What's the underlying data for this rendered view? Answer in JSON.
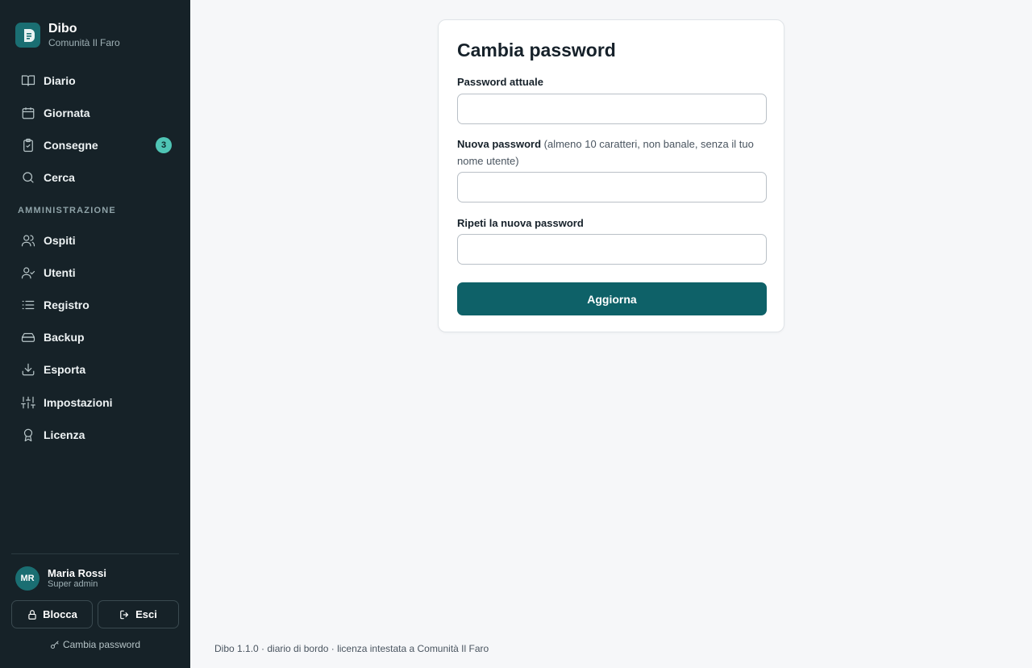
{
  "brand": {
    "name": "Dibo",
    "subtitle": "Comunità Il Faro"
  },
  "nav": {
    "main": [
      {
        "label": "Diario",
        "icon": "book-icon"
      },
      {
        "label": "Giornata",
        "icon": "calendar-icon"
      },
      {
        "label": "Consegne",
        "icon": "clipboard-check-icon",
        "badge": "3"
      },
      {
        "label": "Cerca",
        "icon": "search-icon"
      }
    ],
    "section_label": "AMMINISTRAZIONE",
    "admin": [
      {
        "label": "Ospiti",
        "icon": "users-icon"
      },
      {
        "label": "Utenti",
        "icon": "user-check-icon"
      },
      {
        "label": "Registro",
        "icon": "list-icon"
      },
      {
        "label": "Backup",
        "icon": "hard-drive-icon"
      },
      {
        "label": "Esporta",
        "icon": "download-icon"
      },
      {
        "label": "Impostazioni",
        "icon": "sliders-icon"
      },
      {
        "label": "Licenza",
        "icon": "award-icon"
      }
    ]
  },
  "user": {
    "initials": "MR",
    "name": "Maria Rossi",
    "role": "Super admin"
  },
  "sidebar_actions": {
    "lock_label": "Blocca",
    "logout_label": "Esci",
    "change_password_label": "Cambia password"
  },
  "form": {
    "title": "Cambia password",
    "current_label": "Password attuale",
    "current_value": "",
    "new_label": "Nuova password",
    "new_hint": "(almeno 10 caratteri, non banale, senza il tuo nome utente)",
    "new_value": "",
    "repeat_label": "Ripeti la nuova password",
    "repeat_value": "",
    "submit_label": "Aggiorna"
  },
  "footer": {
    "text": "Dibo 1.1.0 · diario di bordo · licenza intestata a Comunità Il Faro"
  },
  "colors": {
    "sidebar_bg": "#162228",
    "accent": "#0e6168",
    "badge": "#4fc5b5",
    "page_bg": "#f6f7f9"
  }
}
